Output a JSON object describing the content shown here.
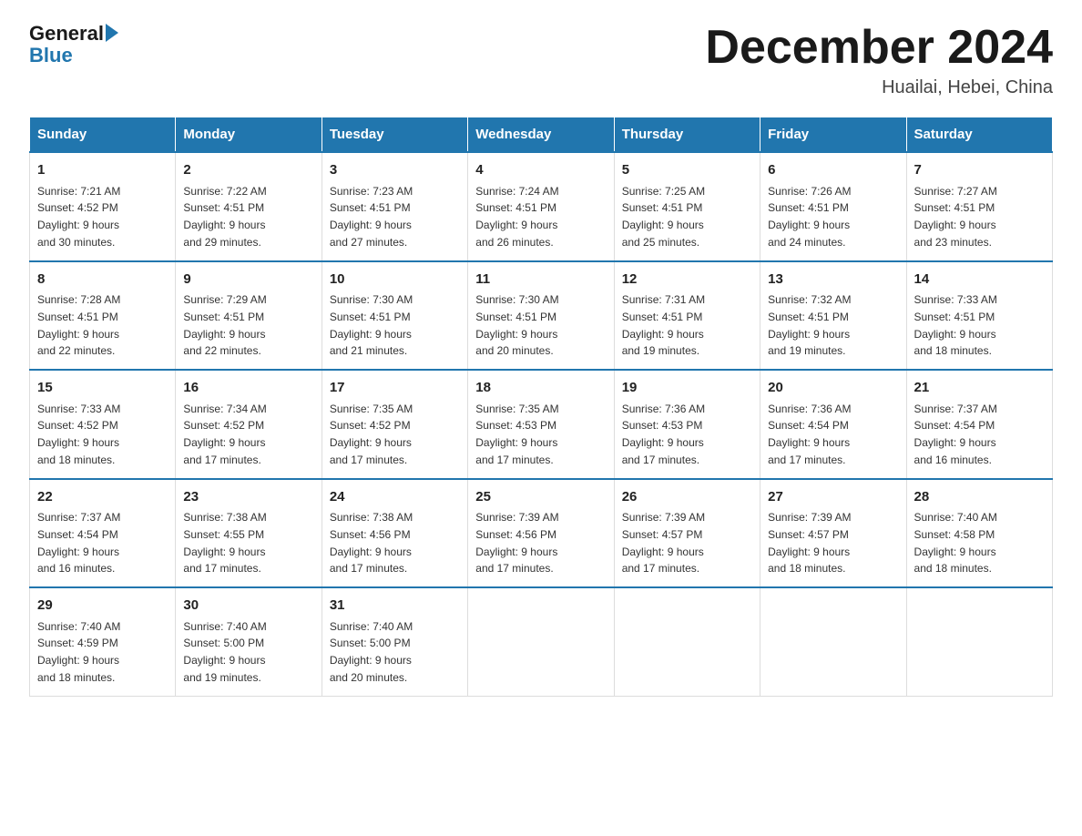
{
  "logo": {
    "general": "General",
    "blue": "Blue"
  },
  "title": "December 2024",
  "location": "Huailai, Hebei, China",
  "weekdays": [
    "Sunday",
    "Monday",
    "Tuesday",
    "Wednesday",
    "Thursday",
    "Friday",
    "Saturday"
  ],
  "weeks": [
    [
      {
        "day": "1",
        "sunrise": "7:21 AM",
        "sunset": "4:52 PM",
        "daylight": "9 hours and 30 minutes."
      },
      {
        "day": "2",
        "sunrise": "7:22 AM",
        "sunset": "4:51 PM",
        "daylight": "9 hours and 29 minutes."
      },
      {
        "day": "3",
        "sunrise": "7:23 AM",
        "sunset": "4:51 PM",
        "daylight": "9 hours and 27 minutes."
      },
      {
        "day": "4",
        "sunrise": "7:24 AM",
        "sunset": "4:51 PM",
        "daylight": "9 hours and 26 minutes."
      },
      {
        "day": "5",
        "sunrise": "7:25 AM",
        "sunset": "4:51 PM",
        "daylight": "9 hours and 25 minutes."
      },
      {
        "day": "6",
        "sunrise": "7:26 AM",
        "sunset": "4:51 PM",
        "daylight": "9 hours and 24 minutes."
      },
      {
        "day": "7",
        "sunrise": "7:27 AM",
        "sunset": "4:51 PM",
        "daylight": "9 hours and 23 minutes."
      }
    ],
    [
      {
        "day": "8",
        "sunrise": "7:28 AM",
        "sunset": "4:51 PM",
        "daylight": "9 hours and 22 minutes."
      },
      {
        "day": "9",
        "sunrise": "7:29 AM",
        "sunset": "4:51 PM",
        "daylight": "9 hours and 22 minutes."
      },
      {
        "day": "10",
        "sunrise": "7:30 AM",
        "sunset": "4:51 PM",
        "daylight": "9 hours and 21 minutes."
      },
      {
        "day": "11",
        "sunrise": "7:30 AM",
        "sunset": "4:51 PM",
        "daylight": "9 hours and 20 minutes."
      },
      {
        "day": "12",
        "sunrise": "7:31 AM",
        "sunset": "4:51 PM",
        "daylight": "9 hours and 19 minutes."
      },
      {
        "day": "13",
        "sunrise": "7:32 AM",
        "sunset": "4:51 PM",
        "daylight": "9 hours and 19 minutes."
      },
      {
        "day": "14",
        "sunrise": "7:33 AM",
        "sunset": "4:51 PM",
        "daylight": "9 hours and 18 minutes."
      }
    ],
    [
      {
        "day": "15",
        "sunrise": "7:33 AM",
        "sunset": "4:52 PM",
        "daylight": "9 hours and 18 minutes."
      },
      {
        "day": "16",
        "sunrise": "7:34 AM",
        "sunset": "4:52 PM",
        "daylight": "9 hours and 17 minutes."
      },
      {
        "day": "17",
        "sunrise": "7:35 AM",
        "sunset": "4:52 PM",
        "daylight": "9 hours and 17 minutes."
      },
      {
        "day": "18",
        "sunrise": "7:35 AM",
        "sunset": "4:53 PM",
        "daylight": "9 hours and 17 minutes."
      },
      {
        "day": "19",
        "sunrise": "7:36 AM",
        "sunset": "4:53 PM",
        "daylight": "9 hours and 17 minutes."
      },
      {
        "day": "20",
        "sunrise": "7:36 AM",
        "sunset": "4:54 PM",
        "daylight": "9 hours and 17 minutes."
      },
      {
        "day": "21",
        "sunrise": "7:37 AM",
        "sunset": "4:54 PM",
        "daylight": "9 hours and 16 minutes."
      }
    ],
    [
      {
        "day": "22",
        "sunrise": "7:37 AM",
        "sunset": "4:54 PM",
        "daylight": "9 hours and 16 minutes."
      },
      {
        "day": "23",
        "sunrise": "7:38 AM",
        "sunset": "4:55 PM",
        "daylight": "9 hours and 17 minutes."
      },
      {
        "day": "24",
        "sunrise": "7:38 AM",
        "sunset": "4:56 PM",
        "daylight": "9 hours and 17 minutes."
      },
      {
        "day": "25",
        "sunrise": "7:39 AM",
        "sunset": "4:56 PM",
        "daylight": "9 hours and 17 minutes."
      },
      {
        "day": "26",
        "sunrise": "7:39 AM",
        "sunset": "4:57 PM",
        "daylight": "9 hours and 17 minutes."
      },
      {
        "day": "27",
        "sunrise": "7:39 AM",
        "sunset": "4:57 PM",
        "daylight": "9 hours and 18 minutes."
      },
      {
        "day": "28",
        "sunrise": "7:40 AM",
        "sunset": "4:58 PM",
        "daylight": "9 hours and 18 minutes."
      }
    ],
    [
      {
        "day": "29",
        "sunrise": "7:40 AM",
        "sunset": "4:59 PM",
        "daylight": "9 hours and 18 minutes."
      },
      {
        "day": "30",
        "sunrise": "7:40 AM",
        "sunset": "5:00 PM",
        "daylight": "9 hours and 19 minutes."
      },
      {
        "day": "31",
        "sunrise": "7:40 AM",
        "sunset": "5:00 PM",
        "daylight": "9 hours and 20 minutes."
      },
      null,
      null,
      null,
      null
    ]
  ]
}
